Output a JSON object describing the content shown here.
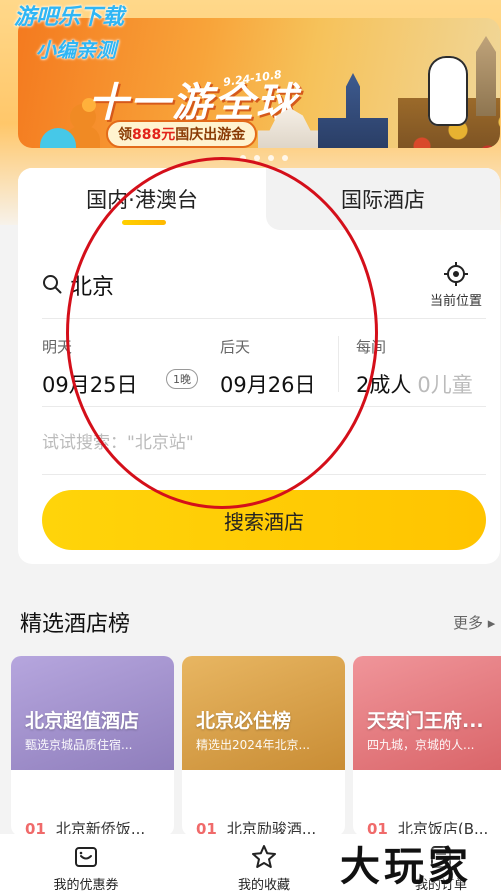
{
  "watermark": {
    "line1": "游吧乐下载",
    "line2": "小编亲测"
  },
  "banner": {
    "dates": "9.24-10.8",
    "title": "十一游全球",
    "pill_prefix": "领",
    "pill_amount": "888元",
    "pill_suffix": "国庆出游金"
  },
  "tabs": {
    "domestic": "国内·港澳台",
    "international": "国际酒店"
  },
  "search": {
    "city": "北京",
    "location_label": "当前位置",
    "checkin_label": "明天",
    "checkin_date": "09月25日",
    "nights": "1晚",
    "checkout_label": "后天",
    "checkout_date": "09月26日",
    "guests_label": "每间",
    "adults": "2成人",
    "children": "0儿童",
    "hint": "试试搜索：\"北京站\"",
    "button": "搜索酒店"
  },
  "ranking": {
    "title": "精选酒店榜",
    "more": "更多 ▸",
    "cards": [
      {
        "title": "北京超值酒店",
        "subtitle": "甄选京城品质住宿...",
        "num": "01",
        "first_item": "北京新侨饭...",
        "color": "#9f8fc8"
      },
      {
        "title": "北京必住榜",
        "subtitle": "精选出2024年北京...",
        "num": "01",
        "first_item": "北京励骏酒...",
        "color": "#d9a24a"
      },
      {
        "title": "天安门王府...",
        "subtitle": "四九城，京城的人...",
        "num": "01",
        "first_item": "北京饭店(B...",
        "color": "#e57a7a"
      }
    ]
  },
  "nav": {
    "coupons": "我的优惠券",
    "favorites": "我的收藏",
    "orders": "我的订单"
  },
  "brand_watermark": "大玩家"
}
